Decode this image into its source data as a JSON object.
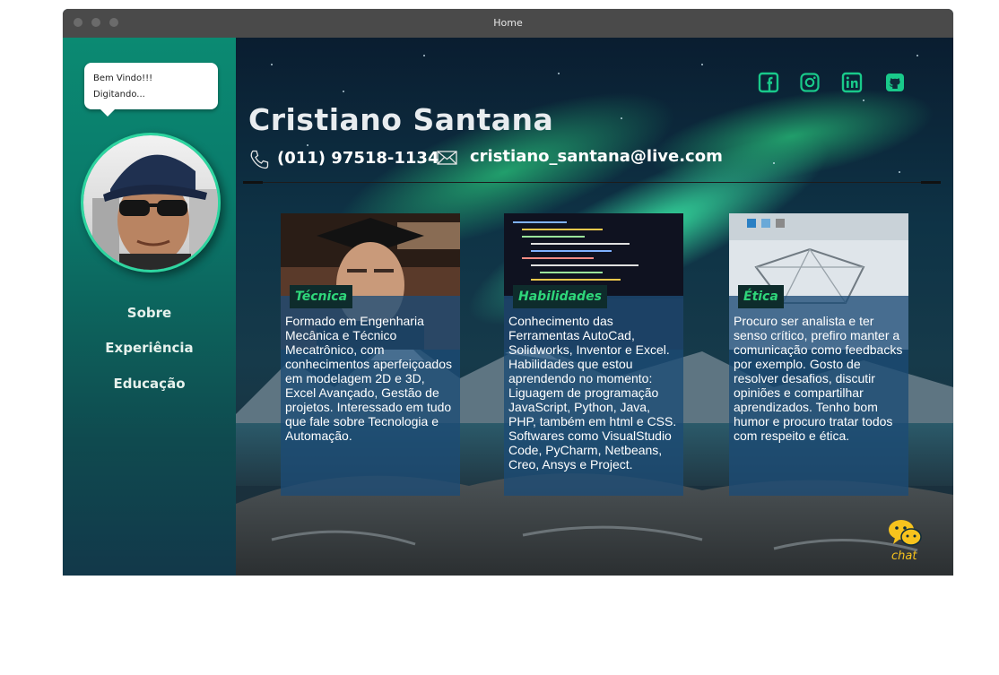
{
  "window": {
    "title": "Home"
  },
  "sidebar": {
    "bubble": {
      "line1": "Bem Vindo!!!",
      "line2": "Digitando..."
    },
    "nav": [
      {
        "label": "Sobre"
      },
      {
        "label": "Experiência"
      },
      {
        "label": "Educação"
      }
    ]
  },
  "header": {
    "name": "Cristiano Santana",
    "phone": "(011) 97518-1134",
    "email": "cristiano_santana@live.com",
    "social": [
      "facebook-icon",
      "instagram-icon",
      "linkedin-icon",
      "github-icon"
    ]
  },
  "cards": [
    {
      "title": "Técnica",
      "text": "Formado em Engenharia Mecânica e Técnico Mecatrônico, com conhecimentos aperfeiçoados em modelagem 2D e 3D, Excel Avançado, Gestão de projetos.  Interessado em tudo que fale sobre Tecnologia e Automação."
    },
    {
      "title": "Habilidades",
      "text": "Conhecimento das Ferramentas AutoCad, Solidworks, Inventor e Excel. Habilidades que estou aprendendo no momento: Liguagem de programação JavaScript, Python, Java, PHP, também em html e CSS. Softwares como VisualStudio Code, PyCharm, Netbeans, Creo, Ansys e Project."
    },
    {
      "title": "Ética",
      "text": "Procuro ser analista e ter senso crítico, prefiro manter a comunicação como feedbacks por exemplo. Gosto de resolver desafios, discutir opiniões e compartilhar aprendizados. Tenho bom humor e procuro tratar todos com respeito e ética."
    }
  ],
  "chat": {
    "label": "chat"
  },
  "colors": {
    "accent": "#19c98a",
    "tag_text": "#2fd67a",
    "chat": "#f7c31d",
    "sidebar": "#0b8a72"
  }
}
